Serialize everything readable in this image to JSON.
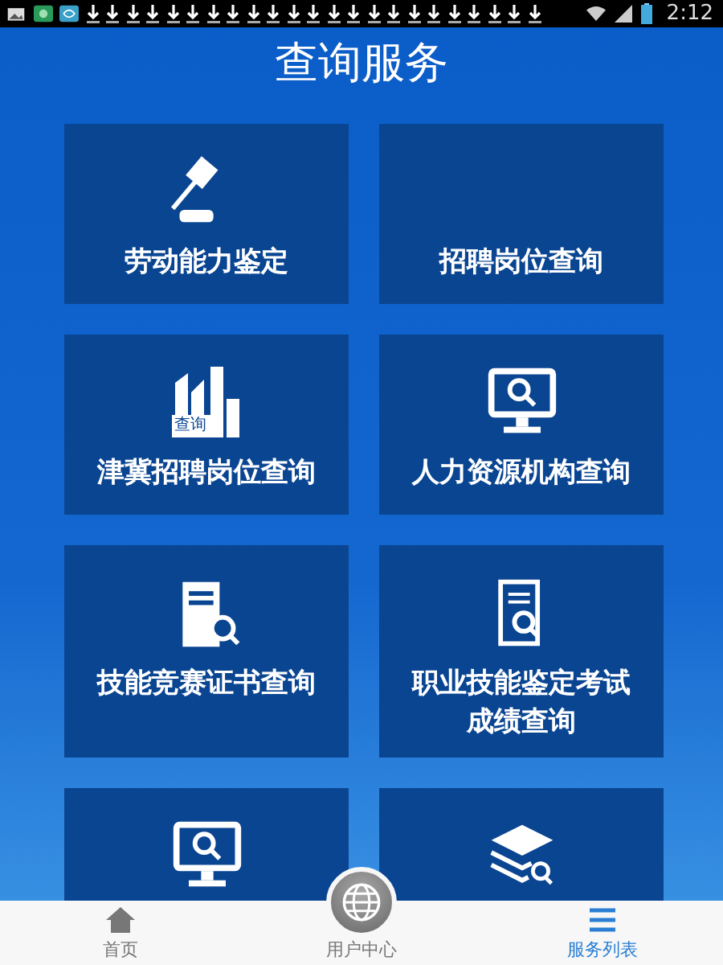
{
  "status_bar": {
    "time": "2:12"
  },
  "title": "查询服务",
  "tiles": [
    {
      "kind": "gavel",
      "lines": [
        "劳动能力鉴定"
      ]
    },
    {
      "kind": "none",
      "lines": [
        "招聘岗位查询"
      ]
    },
    {
      "kind": "building",
      "badge": "查询",
      "lines": [
        "津冀招聘岗位查询"
      ]
    },
    {
      "kind": "monitor",
      "lines": [
        "人力资源机构查询"
      ]
    },
    {
      "kind": "certificate",
      "lines": [
        "技能竞赛证书查询"
      ]
    },
    {
      "kind": "report",
      "lines": [
        "职业技能鉴定考试",
        "成绩查询"
      ]
    },
    {
      "kind": "monitor"
    },
    {
      "kind": "stack"
    }
  ],
  "nav": [
    {
      "kind": "home",
      "label": "首页",
      "selected": false
    },
    {
      "kind": "globe",
      "label": "用户中心",
      "selected": false
    },
    {
      "kind": "list",
      "label": "服务列表",
      "selected": true
    }
  ]
}
